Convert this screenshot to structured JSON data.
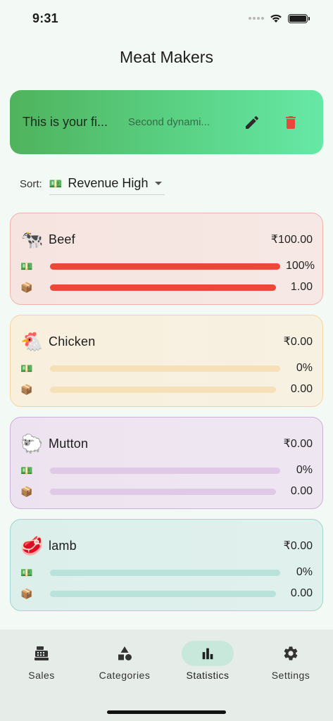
{
  "status_bar": {
    "time": "9:31"
  },
  "header": {
    "title": "Meat Makers"
  },
  "banner": {
    "title": "This is your fi...",
    "subtitle": "Second dynami...",
    "edit_icon": "pencil-icon",
    "delete_icon": "trash-icon",
    "accent_delete": "#e9463c"
  },
  "sort": {
    "label": "Sort:",
    "icon": "💵",
    "selected": "Revenue High"
  },
  "products": [
    {
      "name": "Beef",
      "emoji": "🐄",
      "total": "₹100.00",
      "revenue_icon": "💵",
      "revenue_pct_label": "100%",
      "revenue_fraction": 1.0,
      "qty_icon": "📦",
      "qty_label": "1.00",
      "qty_fraction": 1.0,
      "bg": "#f6e4e0",
      "border": "#f0b3ab",
      "track": "#f5c8c0",
      "fill": "#ee4637"
    },
    {
      "name": "Chicken",
      "emoji": "🐔",
      "total": "₹0.00",
      "revenue_icon": "💵",
      "revenue_pct_label": "0%",
      "revenue_fraction": 0,
      "qty_icon": "📦",
      "qty_label": "0.00",
      "qty_fraction": 0,
      "bg": "#f8efdd",
      "border": "#f4d59f",
      "track": "#f5e0b8",
      "fill": "#f3b64a"
    },
    {
      "name": "Mutton",
      "emoji": "🐑",
      "total": "₹0.00",
      "revenue_icon": "💵",
      "revenue_pct_label": "0%",
      "revenue_fraction": 0,
      "qty_icon": "📦",
      "qty_label": "0.00",
      "qty_fraction": 0,
      "bg": "#ede3f0",
      "border": "#cfaedb",
      "track": "#e0c8e7",
      "fill": "#a05cc0"
    },
    {
      "name": "lamb",
      "emoji": "🥩",
      "total": "₹0.00",
      "revenue_icon": "💵",
      "revenue_pct_label": "0%",
      "revenue_fraction": 0,
      "qty_icon": "📦",
      "qty_label": "0.00",
      "qty_fraction": 0,
      "bg": "#dcefeb",
      "border": "#9fd6cd",
      "track": "#b9e2db",
      "fill": "#2fa390"
    }
  ],
  "nav": {
    "items": [
      {
        "label": "Sales",
        "icon": "cash-register-icon",
        "active": false
      },
      {
        "label": "Categories",
        "icon": "shapes-icon",
        "active": false
      },
      {
        "label": "Statistics",
        "icon": "bar-chart-icon",
        "active": true
      },
      {
        "label": "Settings",
        "icon": "gear-icon",
        "active": false
      }
    ]
  }
}
